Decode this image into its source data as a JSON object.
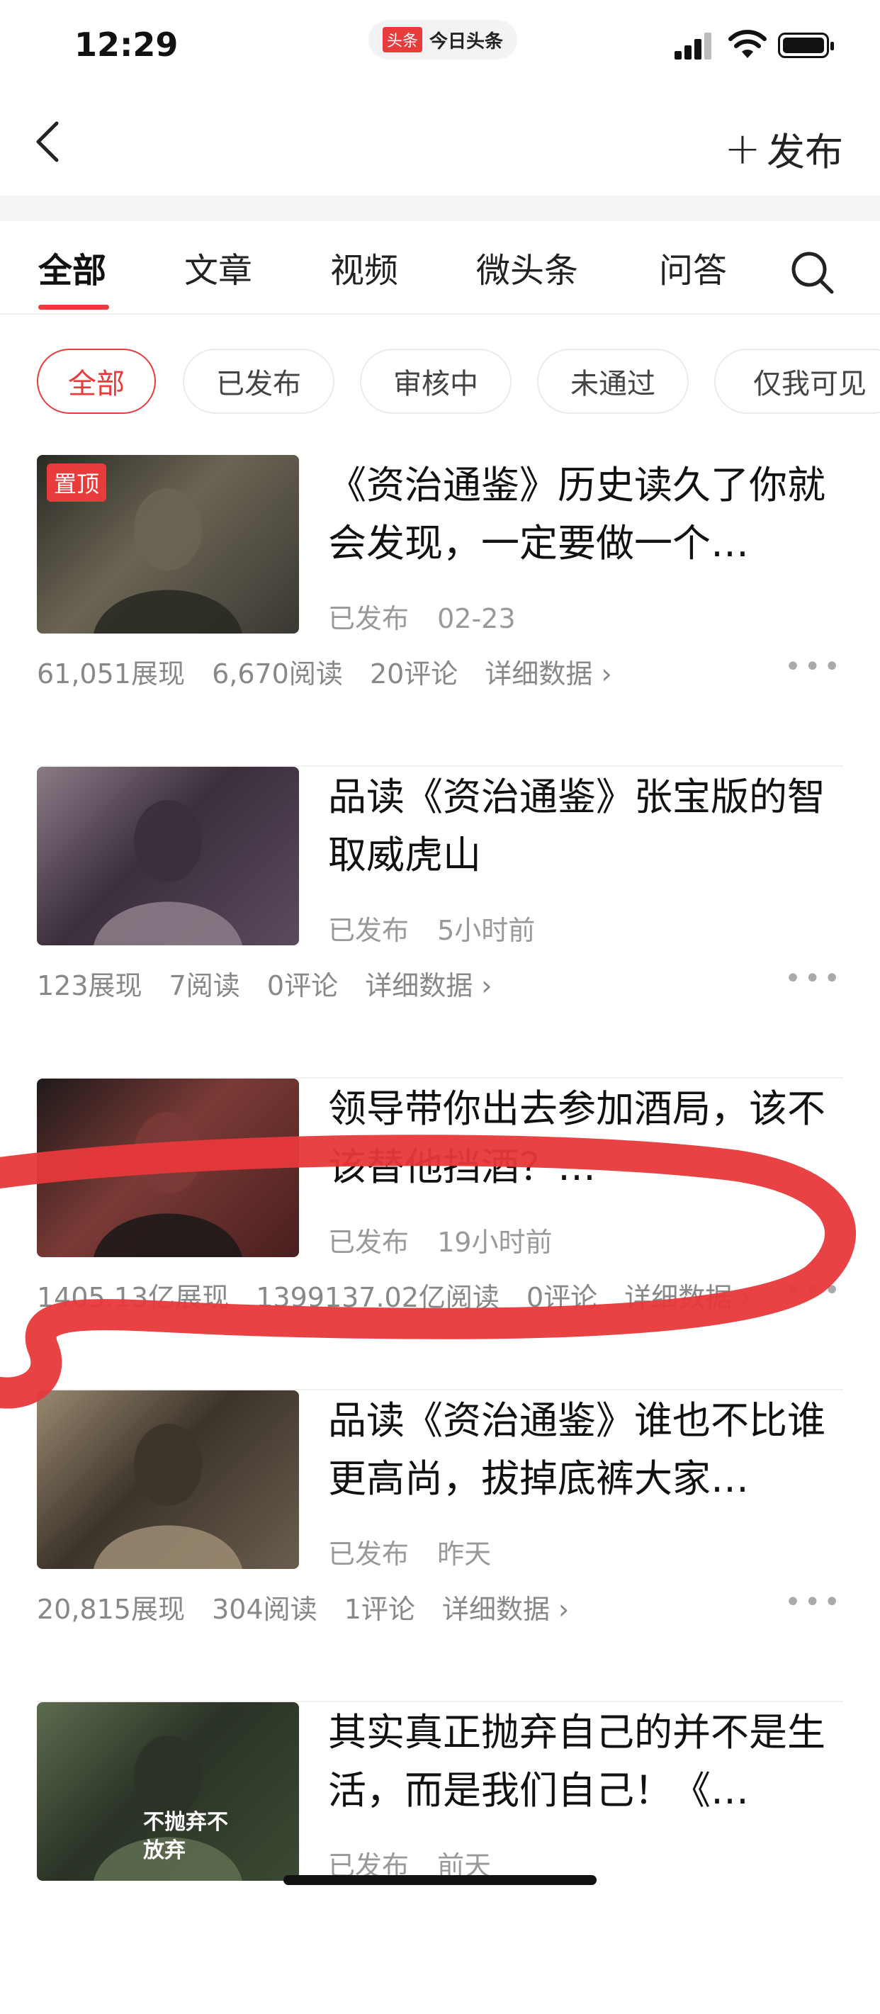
{
  "status_bar": {
    "time": "12:29",
    "app_logo": "头条",
    "app_name": "今日头条"
  },
  "nav": {
    "publish_label": "发布"
  },
  "tabs": [
    {
      "label": "全部"
    },
    {
      "label": "文章"
    },
    {
      "label": "视频"
    },
    {
      "label": "微头条"
    },
    {
      "label": "问答"
    }
  ],
  "chips": [
    {
      "label": "全部"
    },
    {
      "label": "已发布"
    },
    {
      "label": "审核中"
    },
    {
      "label": "未通过"
    },
    {
      "label": "仅我可见"
    }
  ],
  "articles": [
    {
      "pinned": "置顶",
      "title": "《资治通鉴》历史读久了你就会发现，一定要做一个…",
      "status": "已发布",
      "date": "02-23",
      "impressions": "61,051展现",
      "reads": "6,670阅读",
      "comments": "20评论",
      "detail": "详细数据 ›",
      "thumb_colors": [
        "#3a3833",
        "#6b6454",
        "#2a2a24"
      ]
    },
    {
      "title": "品读《资治通鉴》张宝版的智取威虎山",
      "status": "已发布",
      "date": "5小时前",
      "impressions": "123展现",
      "reads": "7阅读",
      "comments": "0评论",
      "detail": "详细数据 ›",
      "thumb_colors": [
        "#5a4a5e",
        "#3b2f3c",
        "#8a7a86"
      ]
    },
    {
      "title": "领导带你出去参加酒局，该不该替他挡酒？…",
      "status": "已发布",
      "date": "19小时前",
      "impressions": "1405.13亿展现",
      "reads": "1399137.02亿阅读",
      "comments": "0评论",
      "detail": "详细数据 ›",
      "thumb_colors": [
        "#4a1f1f",
        "#7a3a36",
        "#1f1a1a"
      ]
    },
    {
      "title": "品读《资治通鉴》谁也不比谁更高尚，拔掉底裤大家…",
      "status": "已发布",
      "date": "昨天",
      "impressions": "20,815展现",
      "reads": "304阅读",
      "comments": "1评论",
      "detail": "详细数据 ›",
      "thumb_colors": [
        "#6a5d4e",
        "#3c342b",
        "#9a8870"
      ]
    },
    {
      "title": "其实真正抛弃自己的并不是生活，而是我们自己！《…",
      "status": "已发布",
      "date": "前天",
      "thumb_text": "不抛弃不放弃",
      "thumb_colors": [
        "#3b4a33",
        "#2a3326",
        "#5d6b4f"
      ]
    }
  ],
  "colors": {
    "accent": "#e83b3b",
    "annotation": "#e8383b"
  }
}
